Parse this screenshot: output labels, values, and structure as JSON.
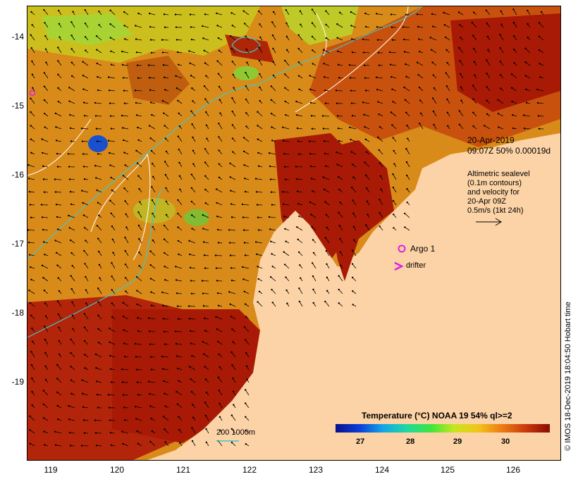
{
  "map": {
    "y_axis_labels": [
      "-14",
      "-15",
      "-16",
      "-17",
      "-18",
      "-19"
    ],
    "x_axis_labels": [
      "119",
      "120",
      "121",
      "122",
      "123",
      "124",
      "125",
      "126"
    ],
    "info": {
      "date": "20-Apr-2019",
      "time_line": "09:07Z  50% 0.00019d",
      "altimetric_lines": [
        "Altimetric sealevel",
        "(0.1m contours)",
        "and velocity for",
        "20-Apr 09Z",
        "0.5m/s (1kt 24h)"
      ]
    },
    "legend": {
      "argo_label": "Argo 1",
      "drifter_label": "drifter",
      "depth_label": "200  1000m"
    },
    "colorbar": {
      "title": "Temperature (°C) NOAA 19 54% ql>=2",
      "ticks": [
        "27",
        "28",
        "29",
        "30"
      ]
    },
    "credit": "© IMOS 18-Dec-2019 18:04:50 Hobart time",
    "colors": {
      "land": "#fcd3a6",
      "sea_warm": "#d98b1a",
      "sea_hot": "#a81a05",
      "sea_cool": "#c8e61f",
      "contour_depth": "#3fc8c8",
      "contour_sealevel": "#ffffff",
      "marker": "#e020e0"
    }
  }
}
